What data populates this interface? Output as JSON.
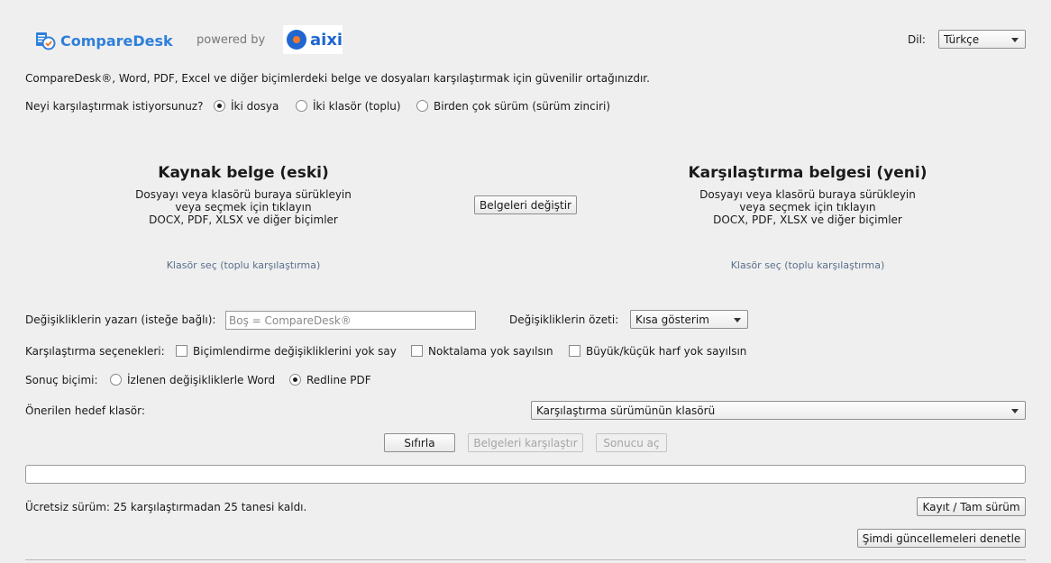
{
  "header": {
    "brand_name": "CompareDesk",
    "powered_by": "powered by",
    "partner_logo_text": "aixi",
    "language_label": "Dil:",
    "language_value": "Türkçe"
  },
  "intro": {
    "tagline": "CompareDesk®, Word, PDF, Excel ve diğer biçimlerdeki belge ve dosyaları karşılaştırmak için güvenilir ortağınızdır."
  },
  "mode": {
    "question": "Neyi karşılaştırmak istiyorsunuz?",
    "options": [
      "İki dosya",
      "İki klasör (toplu)",
      "Birden çok sürüm (sürüm zinciri)"
    ],
    "selected_index": 0
  },
  "source_panel": {
    "title": "Kaynak belge (eski)",
    "line1": "Dosyayı veya klasörü buraya sürükleyin",
    "line2": "veya seçmek için tıklayın",
    "line3": "DOCX, PDF, XLSX ve diğer biçimler",
    "folder_link": "Klasör seç (toplu karşılaştırma)"
  },
  "compare_panel": {
    "title": "Karşılaştırma belgesi (yeni)",
    "line1": "Dosyayı veya klasörü buraya sürükleyin",
    "line2": "veya seçmek için tıklayın",
    "line3": "DOCX, PDF, XLSX ve diğer biçimler",
    "folder_link": "Klasör seç (toplu karşılaştırma)"
  },
  "swap_button": "Belgeleri değiştir",
  "author": {
    "label": "Değişikliklerin yazarı (isteğe bağlı):",
    "placeholder": "Boş = CompareDesk®"
  },
  "summary": {
    "label": "Değişikliklerin özeti:",
    "value": "Kısa gösterim"
  },
  "compare_options": {
    "label": "Karşılaştırma seçenekleri:",
    "ignore_formatting": "Biçimlendirme değişikliklerini yok say",
    "ignore_punctuation": "Noktalama yok sayılsın",
    "ignore_case": "Büyük/küçük harf yok sayılsın"
  },
  "result_format": {
    "label": "Sonuç biçimi:",
    "options": [
      "İzlenen değişikliklerle Word",
      "Redline PDF"
    ],
    "selected_index": 1
  },
  "target_folder": {
    "label": "Önerilen hedef klasör:",
    "value": "Karşılaştırma sürümünün klasörü"
  },
  "actions": {
    "reset": "Sıfırla",
    "compare": "Belgeleri karşılaştır",
    "open_result": "Sonucu aç"
  },
  "footer": {
    "free_version_text": "Ücretsiz sürüm: 25 karşılaştırmadan 25 tanesi kaldı.",
    "register_button": "Kayıt / Tam sürüm",
    "check_updates_button": "Şimdi güncellemeleri denetle"
  },
  "colors": {
    "brand_blue": "#2f7fd9",
    "brand_orange": "#f07a2a",
    "aixi_blue": "#1f66d1"
  }
}
